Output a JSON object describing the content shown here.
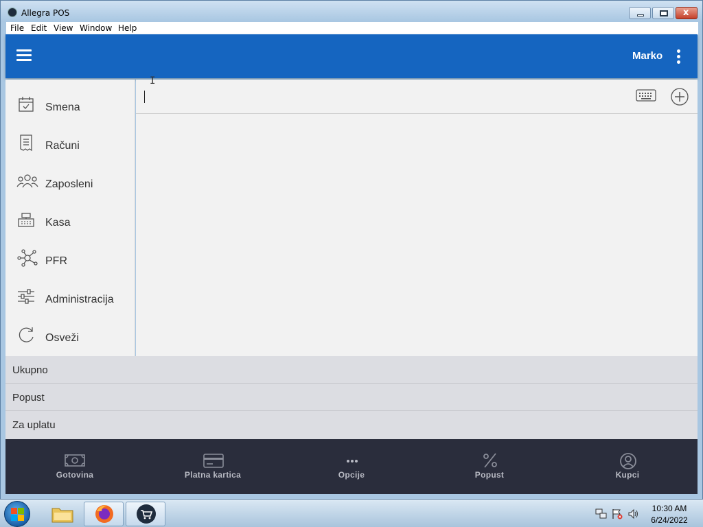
{
  "window": {
    "title": "Allegra POS",
    "controls": {
      "minimize": "minimize",
      "maximize": "maximize",
      "close": "x"
    }
  },
  "menubar": {
    "items": [
      {
        "label": "File"
      },
      {
        "label": "Edit"
      },
      {
        "label": "View"
      },
      {
        "label": "Window"
      },
      {
        "label": "Help"
      }
    ]
  },
  "appbar": {
    "menu_icon": "hamburger-icon",
    "user": "Marko",
    "more_icon": "kebab-icon",
    "color": "#1565c0"
  },
  "sidebar": {
    "items": [
      {
        "label": "Smena",
        "icon": "calendar-check-icon"
      },
      {
        "label": "Računi",
        "icon": "receipt-icon"
      },
      {
        "label": "Zaposleni",
        "icon": "people-icon"
      },
      {
        "label": "Kasa",
        "icon": "cash-register-icon"
      },
      {
        "label": "PFR",
        "icon": "network-icon"
      },
      {
        "label": "Administracija",
        "icon": "sliders-icon"
      },
      {
        "label": "Osveži",
        "icon": "refresh-icon"
      }
    ]
  },
  "search": {
    "value": "",
    "placeholder": "",
    "keyboard_icon": "keyboard-icon",
    "add_icon": "plus-circle-icon"
  },
  "totals": {
    "rows": [
      {
        "label": "Ukupno"
      },
      {
        "label": "Popust"
      },
      {
        "label": "Za uplatu"
      }
    ]
  },
  "bottombar": {
    "items": [
      {
        "label": "Gotovina",
        "icon": "cash-icon"
      },
      {
        "label": "Platna kartica",
        "icon": "card-icon"
      },
      {
        "label": "Opcije",
        "icon": "more-horizontal-icon"
      },
      {
        "label": "Popust",
        "icon": "percent-icon"
      },
      {
        "label": "Kupci",
        "icon": "user-circle-icon"
      }
    ],
    "color": "#2a2d3c"
  },
  "taskbar": {
    "apps": [
      "explorer-icon",
      "firefox-icon",
      "allegra-pos-icon"
    ],
    "clock": {
      "time": "10:30 AM",
      "date": "6/24/2022"
    }
  }
}
